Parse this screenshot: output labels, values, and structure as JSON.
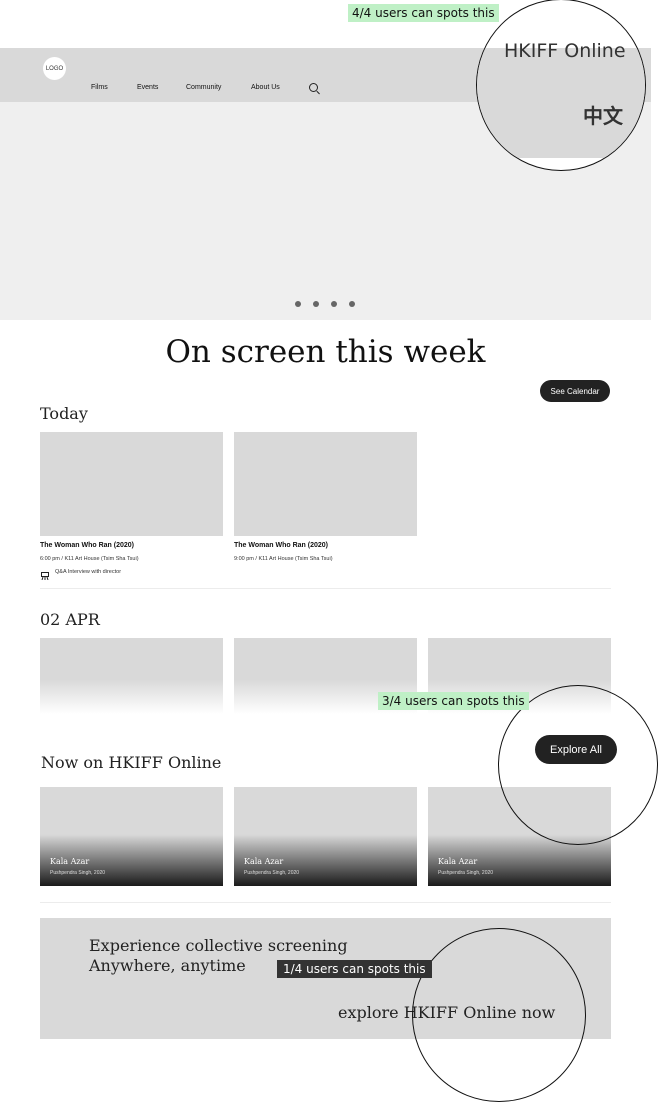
{
  "header": {
    "logo": "LOGO",
    "nav": [
      "Films",
      "Events",
      "Community",
      "About Us"
    ],
    "search_icon": "search-icon"
  },
  "hero": {
    "carousel_dots": 4
  },
  "main": {
    "title": "On screen this week",
    "calendar_button": "See Calendar"
  },
  "today": {
    "heading": "Today",
    "films": [
      {
        "title": "The Woman Who Ran (2020)",
        "meta": "6:00 pm  /  K11 Art House (Tsim Sha Tsui)",
        "extra": "Q&A Interview with director"
      },
      {
        "title": "The Woman Who Ran (2020)",
        "meta": "9:00 pm  /  K11 Art House (Tsim Sha Tsui)"
      }
    ]
  },
  "apr": {
    "heading": "02 APR"
  },
  "online": {
    "heading": "Now on HKIFF Online",
    "explore_button": "Explore All",
    "films": [
      {
        "title": "Kala Azar",
        "meta": "Pushpendra Singh, 2020"
      },
      {
        "title": "Kala Azar",
        "meta": "Pushpendra Singh, 2020"
      },
      {
        "title": "Kala Azar",
        "meta": "Pushpendra Singh, 2020"
      }
    ]
  },
  "promo": {
    "line1": "Experience collective screening",
    "line2": "Anywhere, anytime",
    "link": "explore HKIFF Online now"
  },
  "zoom": {
    "online_link": "HKIFF Online",
    "language": "中文"
  },
  "annotations": {
    "a1": "4/4 users can spots this",
    "a2": "3/4 users can spots this",
    "a3": "1/4 users can spots this"
  }
}
